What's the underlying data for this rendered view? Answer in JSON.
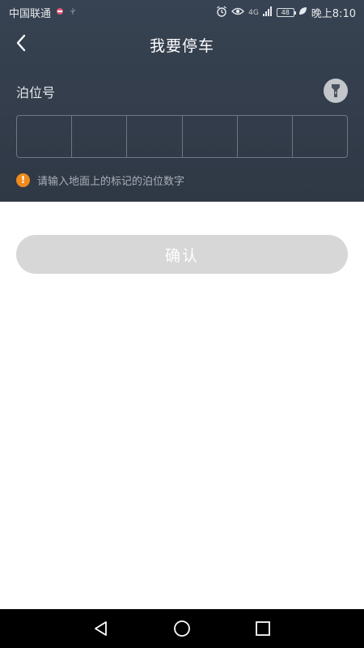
{
  "status_bar": {
    "carrier": "中国联通",
    "network": "4G",
    "battery": "48",
    "time": "晚上8:10",
    "icons": [
      "notification-icon",
      "usb-icon",
      "alarm-icon",
      "eye-comfort-icon",
      "signal-icon",
      "battery-icon",
      "leaf-icon"
    ]
  },
  "header": {
    "title": "我要停车",
    "back_icon": "chevron-left-icon"
  },
  "form": {
    "label": "泊位号",
    "flashlight_icon": "flashlight-icon",
    "digit_count": 6,
    "digits": [
      "",
      "",
      "",
      "",
      "",
      ""
    ],
    "hint_icon": "warning-icon",
    "hint_icon_glyph": "!",
    "hint": "请输入地面上的标记的泊位数字"
  },
  "actions": {
    "confirm_label": "确认"
  },
  "nav_bar": {
    "icons": [
      "back-triangle-icon",
      "home-circle-icon",
      "recents-square-icon"
    ]
  },
  "colors": {
    "header_bg": "#333d4b",
    "warning": "#f08a1d",
    "button_disabled": "#d7d7d7"
  }
}
